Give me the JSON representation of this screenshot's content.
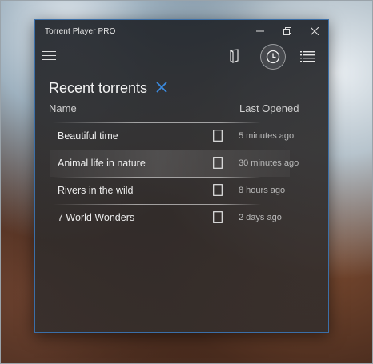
{
  "window": {
    "title": "Torrent Player PRO",
    "controls": {
      "minimize": "—",
      "maximize": "❐",
      "close": "✕"
    }
  },
  "toolbar": {
    "icons": [
      "menu-icon",
      "book-icon",
      "clock-icon",
      "list-icon"
    ],
    "active_icon": "clock-icon"
  },
  "panel": {
    "heading": "Recent torrents",
    "columns": {
      "name": "Name",
      "last_opened": "Last Opened"
    },
    "rows": [
      {
        "name": "Beautiful time",
        "last_opened": "5 minutes ago"
      },
      {
        "name": "Animal life in nature",
        "last_opened": "30  minutes ago"
      },
      {
        "name": "Rivers in the wild",
        "last_opened": "8 hours ago"
      },
      {
        "name": "7 World Wonders",
        "last_opened": "2 days ago"
      }
    ],
    "highlighted_row": 1
  },
  "colors": {
    "accent": "#3b8be0",
    "window_border": "#3b6fa8"
  }
}
